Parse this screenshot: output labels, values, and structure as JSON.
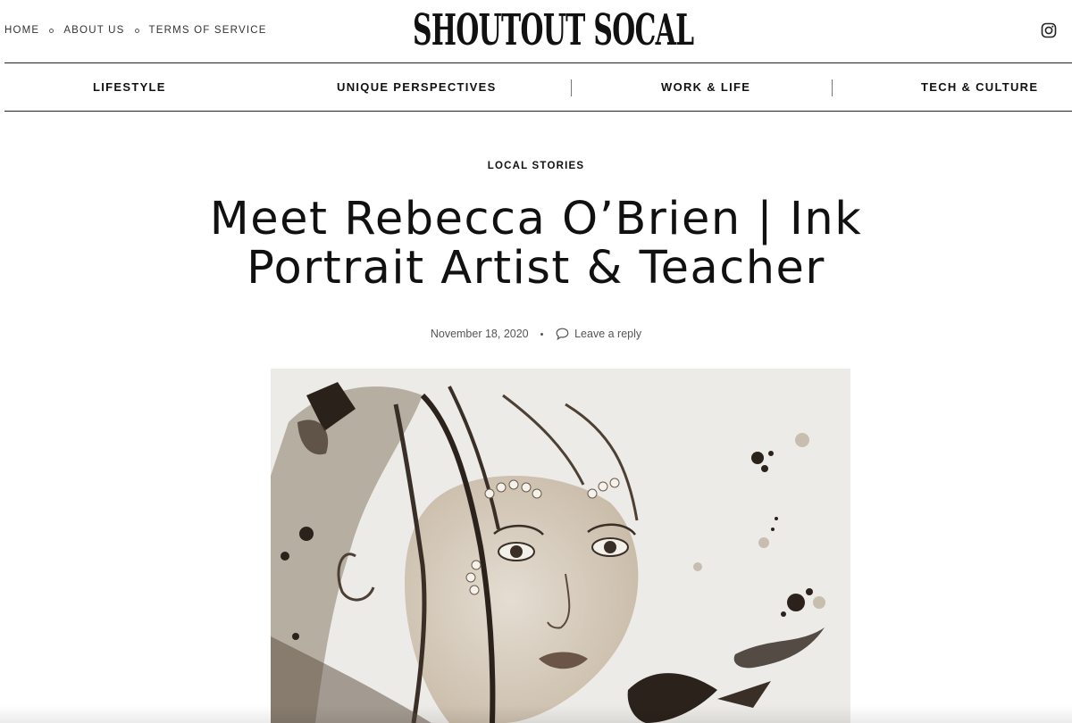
{
  "site": {
    "logo": "SHOUTOUT SOCAL"
  },
  "top_nav": [
    {
      "label": "HOME"
    },
    {
      "label": "ABOUT US"
    },
    {
      "label": "TERMS OF SERVICE"
    }
  ],
  "icons": {
    "social": "instagram-icon",
    "comment": "speech-bubble-icon"
  },
  "category_nav": [
    {
      "label": "LIFESTYLE"
    },
    {
      "label": "UNIQUE PERSPECTIVES"
    },
    {
      "label": "WORK & LIFE"
    },
    {
      "label": "TECH & CULTURE"
    }
  ],
  "article": {
    "category": "LOCAL STORIES",
    "title_line1": "Meet Rebecca O’Brien | Ink",
    "title_line2": "Portrait Artist & Teacher",
    "date": "November 18, 2020",
    "reply_label": "Leave a reply"
  },
  "colors": {
    "ink": "#3a2f27",
    "paper": "#ecebe7",
    "rule": "#222222"
  }
}
